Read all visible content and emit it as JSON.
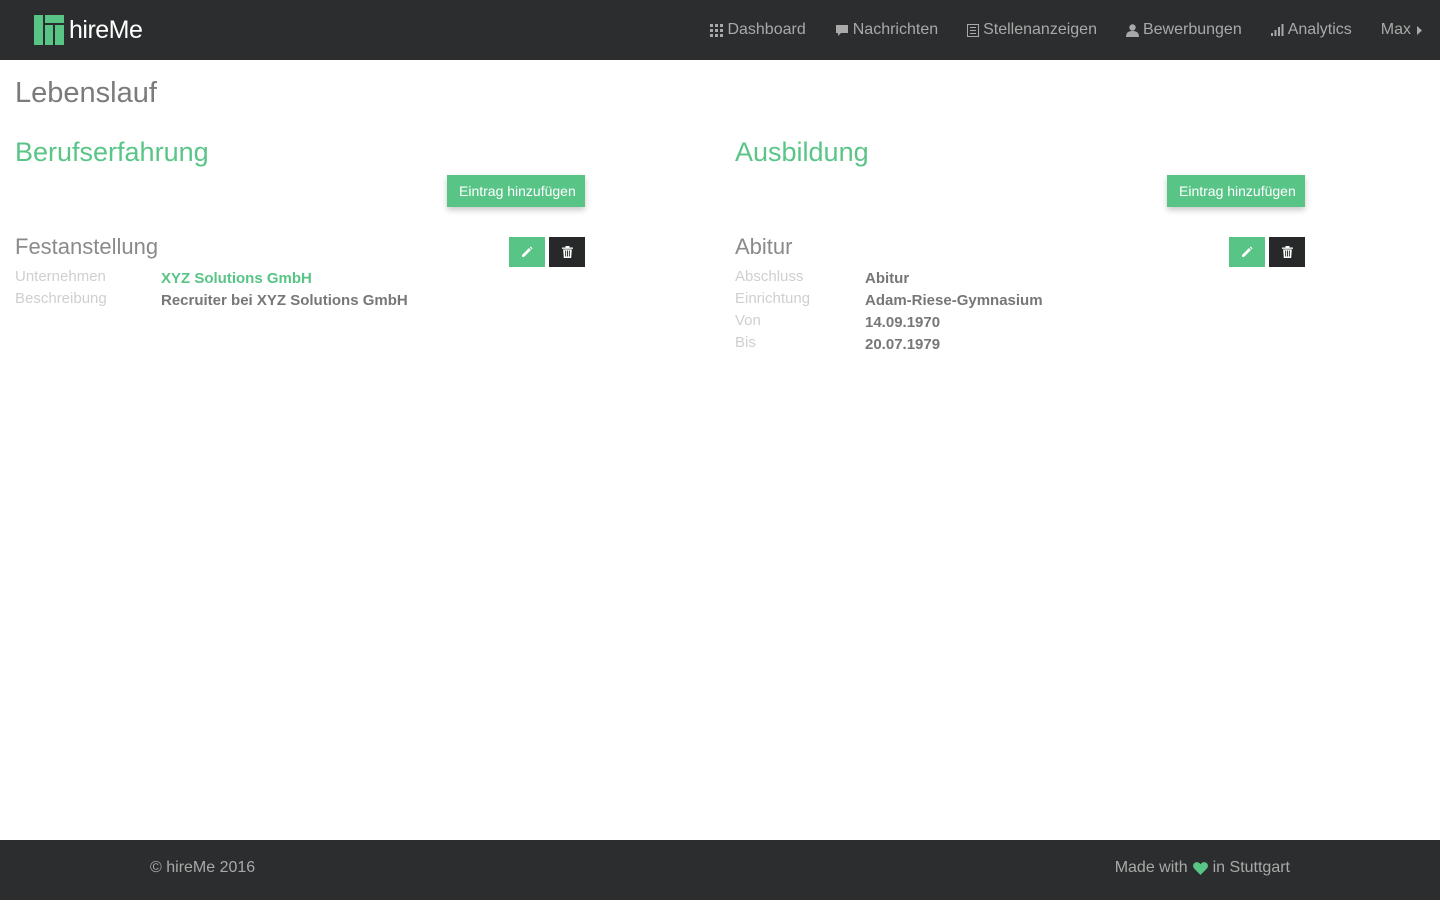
{
  "brand": {
    "name": "hireMe",
    "logo_icon": "hireme-logo-icon",
    "accent_color": "#58c486"
  },
  "nav": {
    "items": [
      {
        "label": "Dashboard",
        "icon": "grid-icon"
      },
      {
        "label": "Nachrichten",
        "icon": "chat-bubble-icon"
      },
      {
        "label": "Stellenanzeigen",
        "icon": "list-icon"
      },
      {
        "label": "Bewerbungen",
        "icon": "user-icon"
      },
      {
        "label": "Analytics",
        "icon": "bar-chart-icon"
      }
    ],
    "user": {
      "label": "Max",
      "icon": "caret-right-icon"
    }
  },
  "page": {
    "title": "Lebenslauf"
  },
  "berufserfahrung": {
    "title": "Berufserfahrung",
    "add_button": "Eintrag hinzufügen",
    "entry": {
      "title": "Festanstellung",
      "fields": [
        {
          "label": "Unternehmen",
          "value": "XYZ Solutions GmbH"
        },
        {
          "label": "Beschreibung",
          "value": "Recruiter bei XYZ Solutions GmbH"
        }
      ]
    }
  },
  "ausbildung": {
    "title": "Ausbildung",
    "add_button": "Eintrag hinzufügen",
    "entry": {
      "title": "Abitur",
      "fields": [
        {
          "label": "Abschluss",
          "value": "Abitur"
        },
        {
          "label": "Einrichtung",
          "value": "Adam-Riese-Gymnasium"
        },
        {
          "label": "Von",
          "value": "14.09.1970"
        },
        {
          "label": "Bis",
          "value": "20.07.1979"
        }
      ]
    }
  },
  "footer": {
    "copyright": "© hireMe 2016",
    "made_with_prefix": "Made with",
    "made_with_suffix": "in Stuttgart",
    "heart_icon": "heart-icon",
    "heart_color": "#58c486"
  }
}
